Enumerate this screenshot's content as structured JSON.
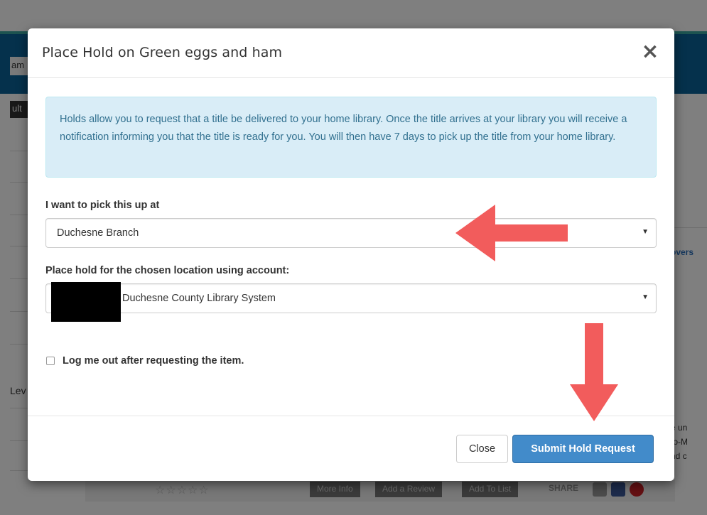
{
  "background": {
    "left_tab_text": "am",
    "left_dark_text": "ult",
    "left_lev_text": "Lev",
    "right_link_text": "overs",
    "right_text_lines": [
      "e un",
      "to-M",
      "nd c"
    ],
    "stars": "☆☆☆☆☆",
    "buttons": [
      "More Info",
      "Add a Review",
      "Add To List"
    ],
    "share_label": "SHARE"
  },
  "modal": {
    "title": "Place Hold on Green eggs and ham",
    "close_glyph": "×",
    "info_text": "Holds allow you to request that a title be delivered to your home library. Once the title arrives at your library you will receive a notification informing you that the title is ready for you. You will then have 7 days to pick up the title from your home library.",
    "pickup_label": "I want to pick this up at",
    "pickup_value": "Duchesne Branch",
    "account_label": "Place hold for the chosen location using account:",
    "account_value": "Duchesne County Library System",
    "logout_label": "Log me out after requesting the item.",
    "logout_checked": false,
    "close_button": "Close",
    "submit_button": "Submit Hold Request"
  },
  "colors": {
    "info_bg": "#d9edf7",
    "info_text": "#31708f",
    "primary": "#428bca",
    "annotation_arrow": "#f25c5c",
    "header_bar": "#0b6398"
  }
}
